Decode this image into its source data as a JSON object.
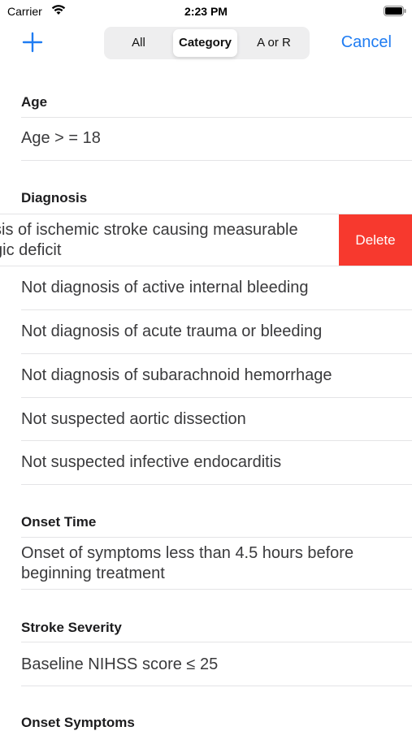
{
  "status_bar": {
    "carrier": "Carrier",
    "time": "2:23 PM"
  },
  "nav": {
    "segments": [
      "All",
      "Category",
      "A or R"
    ],
    "selected_segment": "Category",
    "cancel_label": "Cancel",
    "accent_color": "#1f7cf2"
  },
  "sections": [
    {
      "header": "Age",
      "rows": [
        "Age > = 18"
      ]
    },
    {
      "header": "Diagnosis",
      "swiped_row": {
        "line1": "sis of ischemic stroke causing measurable",
        "line2": "gic deficit",
        "delete_label": "Delete",
        "delete_color": "#f7392e"
      },
      "rows": [
        "Not diagnosis of active internal bleeding",
        "Not diagnosis of acute trauma or bleeding",
        "Not diagnosis of subarachnoid hemorrhage",
        "Not suspected aortic dissection",
        "Not suspected infective endocarditis"
      ]
    },
    {
      "header": "Onset Time",
      "rows": [
        "Onset of symptoms less than 4.5 hours before beginning treatment"
      ]
    },
    {
      "header": "Stroke Severity",
      "rows": [
        "Baseline NIHSS score ≤ 25"
      ]
    },
    {
      "header": "Onset Symptoms",
      "rows": []
    }
  ]
}
